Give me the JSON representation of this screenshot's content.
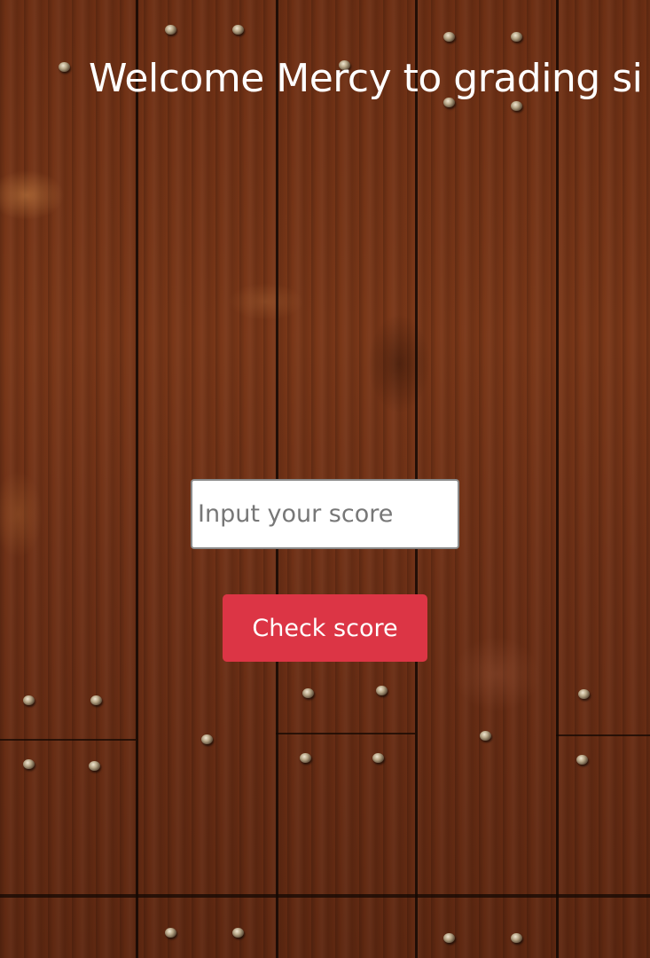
{
  "header": {
    "title": "Welcome Mercy to grading si"
  },
  "form": {
    "score_placeholder": "Input your score",
    "score_value": "",
    "check_button_label": "Check score"
  },
  "colors": {
    "button_bg": "#dc3545",
    "button_text": "#ffffff",
    "title_text": "#ffffff",
    "background": "#6b2f14"
  }
}
